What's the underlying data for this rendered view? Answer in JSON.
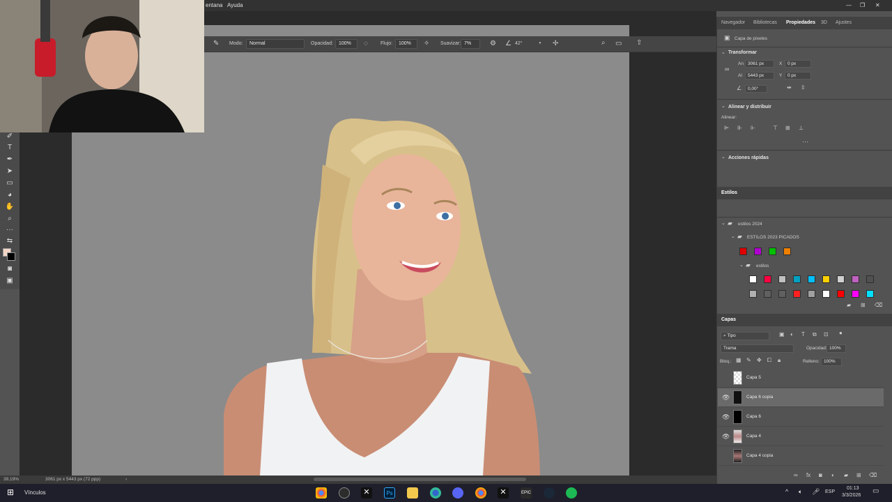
{
  "menubar": {
    "items": [
      "entana",
      "Ayuda"
    ]
  },
  "options": {
    "mode_label": "Modo:",
    "mode_value": "Normal",
    "opacity_label": "Opacidad:",
    "opacity_value": "100%",
    "flow_label": "Flujo:",
    "flow_value": "100%",
    "smooth_label": "Suavizar:",
    "smooth_value": "7%",
    "angle_value": "42°"
  },
  "panel_tabs": [
    "Navegador",
    "Bibliotecas",
    "Propiedades",
    "3D",
    "Ajustes"
  ],
  "properties": {
    "layer_type": "Capa de píxeles",
    "transform_title": "Transformar",
    "w_label": "An",
    "w_value": "3061 px",
    "h_label": "Al",
    "h_value": "5443 px",
    "x_label": "X",
    "x_value": "0 px",
    "y_label": "Y",
    "y_value": "0 px",
    "angle_value": "0,00°",
    "align_title": "Alinear y distribuir",
    "align_label": "Alinear:",
    "quick_title": "Acciones rápidas"
  },
  "styles": {
    "title": "Estilos",
    "group": "estilos 2024",
    "subgroup": "ESTILOS 2023 PICADOS",
    "subfolder": "estilos",
    "colors_row1": [
      "#e00000",
      "#b000d0",
      "#00c000",
      "#f08000"
    ],
    "colors_row2": [
      "#ffffff",
      "#ff0040",
      "#c0c0c0",
      "#00a0c0",
      "#00c0ff",
      "#ffd000",
      "#d0d0d0",
      "#c060c0",
      "#505050"
    ],
    "colors_row3": [
      "#b0b0b0",
      "#606060",
      "#606060",
      "#ff2020",
      "#a0a0a0",
      "#ffffff",
      "#ff0000",
      "#ff00ff",
      "#00e0ff"
    ]
  },
  "layers": {
    "title": "Capas",
    "filter": "Tipo",
    "blend": "Trama",
    "opacity_label": "Opacidad:",
    "opacity_value": "100%",
    "lock_label": "Bloq.:",
    "fill_label": "Relleno:",
    "fill_value": "100%",
    "items": [
      {
        "name": "Capa 5",
        "visible": false
      },
      {
        "name": "Capa 6 copia",
        "visible": true
      },
      {
        "name": "Capa 6",
        "visible": true
      },
      {
        "name": "Capa 4",
        "visible": true
      },
      {
        "name": "Capa 4 copia",
        "visible": false
      }
    ]
  },
  "status": {
    "zoom": "39,19%",
    "doc_info": "3061 px x 5443 px (72 ppp)"
  },
  "taskbar": {
    "search_label": "Vínculos",
    "lang": "ESP",
    "time": "01:13",
    "date": "3/3/2026"
  }
}
